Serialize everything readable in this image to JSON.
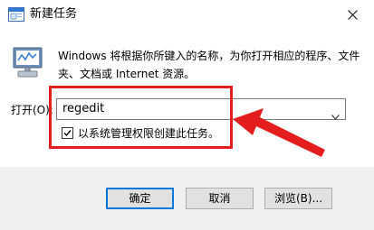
{
  "window": {
    "title": "新建任务",
    "icons": {
      "app": "window-icon",
      "close": "close-icon",
      "run": "run-dialog-icon"
    }
  },
  "dialog": {
    "description": "Windows 将根据你所键入的名称，为你打开相应的程序、文件夹、文档或 Internet 资源。",
    "open_label": "打开(O):",
    "open_value": "regedit",
    "admin_checkbox_label": "以系统管理权限创建此任务。",
    "admin_checked": true
  },
  "buttons": {
    "ok": "确定",
    "cancel": "取消",
    "browse": "浏览(B)..."
  },
  "colors": {
    "annotation": "#e41d1d",
    "focus": "#0078d7",
    "footer": "#f0f0f0"
  }
}
